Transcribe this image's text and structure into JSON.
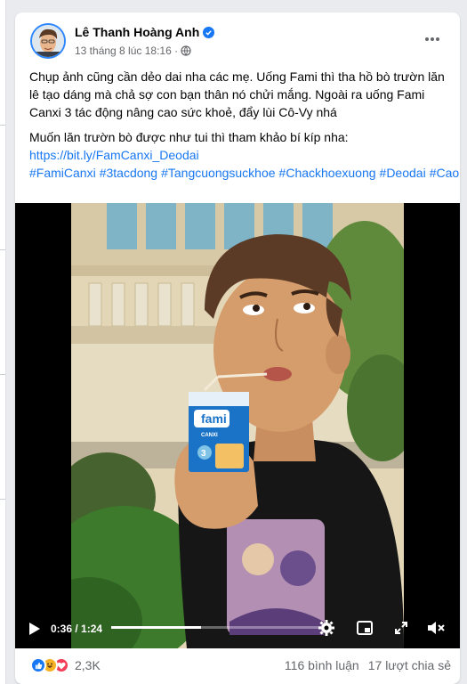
{
  "post": {
    "author": "Lê Thanh Hoàng Anh",
    "timestamp": "13 tháng 8 lúc 18:16 ·",
    "paragraph1": "Chụp ảnh cũng cần dẻo dai nha các mẹ. Uống Fami thì tha hồ bò trườn lăn lê tạo dáng mà chả sợ con bạn thân nó chửi mắng. Ngoài ra uống Fami Canxi 3 tác động nâng cao sức khoẻ, đẩy lùi Cô-Vy nhá",
    "paragraph2": "Muốn lăn trườn bò được như tui thì tham khảo bí kíp nha:",
    "link": "https://bit.ly/FamCanxi_Deodai",
    "hashtags": [
      "#FamiCanxi",
      "#3tacdong",
      "#Tangcuongsuckhoe",
      "#Chackhoexuong",
      "#Deodai",
      "#Caolon"
    ]
  },
  "video": {
    "time_display": "0:36 / 1:24",
    "progress": 0.43,
    "carton_brand": "fami",
    "carton_sub": "CANXI"
  },
  "footer": {
    "reaction_count": "2,3K",
    "comments": "116 bình luận",
    "shares": "17 lượt chia sẻ"
  },
  "colors": {
    "accent": "#1877f2",
    "secondary_text": "#65676b",
    "love": "#f33e58",
    "haha": "#f7b125"
  },
  "icons": [
    "verified-icon",
    "globe-icon",
    "more-icon",
    "play-icon",
    "settings-icon",
    "miniplayer-icon",
    "fullscreen-icon",
    "volume-icon",
    "like-icon",
    "haha-icon",
    "love-icon"
  ]
}
